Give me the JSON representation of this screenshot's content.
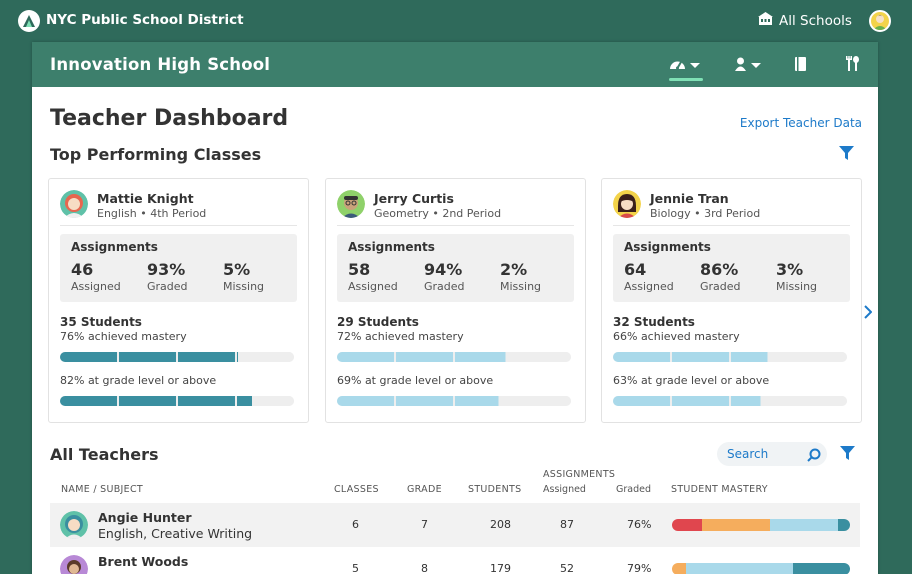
{
  "header": {
    "district": "NYC Public School District",
    "all_schools": "All Schools"
  },
  "school_bar": {
    "name": "Innovation High School"
  },
  "page": {
    "title": "Teacher Dashboard",
    "export_link": "Export Teacher Data",
    "top_classes_title": "Top Performing Classes",
    "all_teachers_title": "All Teachers"
  },
  "cards": [
    {
      "name": "Mattie Knight",
      "subject": "English • 4th Period",
      "assignments_label": "Assignments",
      "assigned": "46",
      "assigned_label": "Assigned",
      "graded": "93%",
      "graded_label": "Graded",
      "missing": "5%",
      "missing_label": "Missing",
      "students": "35 Students",
      "mastery_text": "76% achieved mastery",
      "mastery_value": 0.76,
      "grade_text": "82% at grade level or above",
      "grade_value": 0.82,
      "bar_color": "#3a8fa0"
    },
    {
      "name": "Jerry Curtis",
      "subject": "Geometry • 2nd Period",
      "assignments_label": "Assignments",
      "assigned": "58",
      "assigned_label": "Assigned",
      "graded": "94%",
      "graded_label": "Graded",
      "missing": "2%",
      "missing_label": "Missing",
      "students": "29 Students",
      "mastery_text": "72% achieved mastery",
      "mastery_value": 0.72,
      "grade_text": "69% at grade level or above",
      "grade_value": 0.69,
      "bar_color": "#a9d9ea"
    },
    {
      "name": "Jennie Tran",
      "subject": "Biology • 3rd Period",
      "assignments_label": "Assignments",
      "assigned": "64",
      "assigned_label": "Assigned",
      "graded": "86%",
      "graded_label": "Graded",
      "missing": "3%",
      "missing_label": "Missing",
      "students": "32 Students",
      "mastery_text": "66% achieved mastery",
      "mastery_value": 0.66,
      "grade_text": "63% at grade level or above",
      "grade_value": 0.63,
      "bar_color": "#a9d9ea"
    }
  ],
  "search": {
    "placeholder": "Search"
  },
  "table": {
    "headers": {
      "name": "NAME / SUBJECT",
      "classes": "CLASSES",
      "grade": "GRADE",
      "students": "STUDENTS",
      "assignments": "ASSIGNMENTS",
      "assigned": "Assigned",
      "graded": "Graded",
      "mastery": "STUDENT MASTERY"
    },
    "rows": [
      {
        "name": "Angie Hunter",
        "subject": "English, Creative Writing",
        "classes": "6",
        "grade": "7",
        "students": "208",
        "assigned": "87",
        "graded": "76%",
        "mastery": [
          0.17,
          0.38,
          0.38,
          0.07
        ]
      },
      {
        "name": "Brent Woods",
        "subject": "",
        "classes": "5",
        "grade": "8",
        "students": "179",
        "assigned": "52",
        "graded": "79%",
        "mastery": [
          0.0,
          0.08,
          0.6,
          0.32
        ]
      }
    ]
  },
  "colors": {
    "header_bg": "#2f6a5b",
    "school_bar_bg": "#3d7f6c",
    "accent_link": "#1d7ac9",
    "bar_dark": "#3a8fa0",
    "bar_light": "#a9d9ea",
    "mastery_red": "#e0464e",
    "mastery_orange": "#f5ad5d",
    "mastery_light": "#a9d9ea",
    "mastery_dark": "#3a8fa0"
  }
}
